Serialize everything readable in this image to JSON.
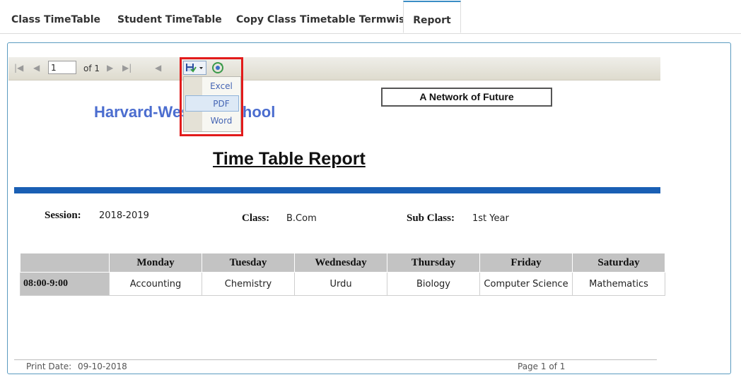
{
  "tabs": [
    {
      "label": "Class TimeTable"
    },
    {
      "label": "Student TimeTable"
    },
    {
      "label": "Copy Class Timetable Termwise"
    },
    {
      "label": "Report"
    }
  ],
  "toolbar": {
    "page_value": "1",
    "page_of": "of 1",
    "export_menu": [
      "Excel",
      "PDF",
      "Word"
    ],
    "export_selected": "PDF"
  },
  "report": {
    "school_name": "Harvard-Western School",
    "tagline": "A Network of Future",
    "title": "Time Table Report",
    "session_label": "Session:",
    "session_value": "2018-2019",
    "class_label": "Class:",
    "class_value": "B.Com",
    "subclass_label": "Sub Class:",
    "subclass_value": "1st Year",
    "days": [
      "Monday",
      "Tuesday",
      "Wednesday",
      "Thursday",
      "Friday",
      "Saturday"
    ],
    "rows": [
      {
        "time": "08:00-9:00",
        "subjects": [
          "Accounting",
          "Chemistry",
          "Urdu",
          "Biology",
          "Computer Science",
          "Mathematics"
        ]
      }
    ],
    "print_date_label": "Print Date:",
    "print_date": "09-10-2018",
    "page_info": "Page 1 of 1"
  },
  "colors": {
    "accent": "#1a5fb4",
    "highlight": "#e21b1b",
    "school": "#4b6dcf"
  }
}
